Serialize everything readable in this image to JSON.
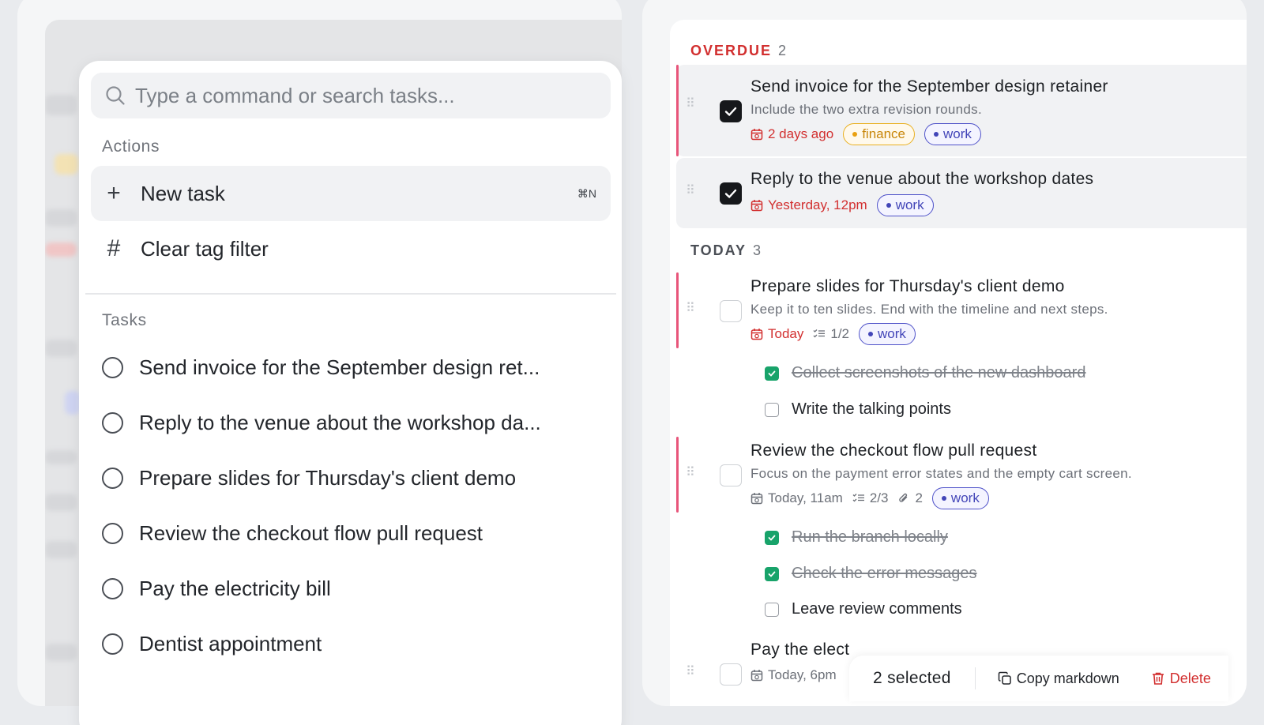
{
  "command_palette": {
    "search": {
      "placeholder": "Type a command or search tasks..."
    },
    "actions_label": "Actions",
    "actions": [
      {
        "icon": "plus-icon",
        "glyph": "+",
        "label": "New task",
        "shortcut": "⌘N"
      },
      {
        "icon": "hash-icon",
        "glyph": "#",
        "label": "Clear tag filter",
        "shortcut": ""
      }
    ],
    "tasks_label": "Tasks",
    "tasks": [
      "Send invoice for the September design ret...",
      "Reply to the venue about the workshop da...",
      "Prepare slides for Thursday's client demo",
      "Review the checkout flow pull request",
      "Pay the electricity bill",
      "Dentist appointment"
    ]
  },
  "task_list": {
    "overdue": {
      "label": "OVERDUE",
      "count": "2"
    },
    "today": {
      "label": "TODAY",
      "count": "3"
    },
    "items": [
      {
        "title": "Send invoice for the September design retainer",
        "description": "Include the two extra revision rounds.",
        "date": "2 days ago",
        "tags": [
          "finance",
          "work"
        ],
        "selected": true
      },
      {
        "title": "Reply to the venue about the workshop dates",
        "date": "Yesterday, 12pm",
        "tags": [
          "work"
        ],
        "selected": true
      },
      {
        "title": "Prepare slides for Thursday's client demo",
        "description": "Keep it to ten slides. End with the timeline and next steps.",
        "date": "Today",
        "subtask_progress": "1/2",
        "tags": [
          "work"
        ],
        "subtasks": [
          {
            "label": "Collect screenshots of the new dashboard",
            "done": true
          },
          {
            "label": "Write the talking points",
            "done": false
          }
        ]
      },
      {
        "title": "Review the checkout flow pull request",
        "description": "Focus on the payment error states and the empty cart screen.",
        "date": "Today, 11am",
        "subtask_progress": "2/3",
        "attachments": "2",
        "tags": [
          "work"
        ],
        "subtasks": [
          {
            "label": "Run the branch locally",
            "done": true
          },
          {
            "label": "Check the error messages",
            "done": true
          },
          {
            "label": "Leave review comments",
            "done": false
          }
        ]
      },
      {
        "title": "Pay the elect",
        "date": "Today, 6pm"
      }
    ]
  },
  "bulk_bar": {
    "selected_text": "2 selected",
    "copy_label": "Copy markdown",
    "delete_label": "Delete"
  },
  "colors": {
    "overdue_red": "#d22f2f",
    "accent_pink": "#e8557a",
    "tag_work": "#4245b8",
    "tag_finance": "#e9a010",
    "subtask_done_green": "#18a36a"
  }
}
